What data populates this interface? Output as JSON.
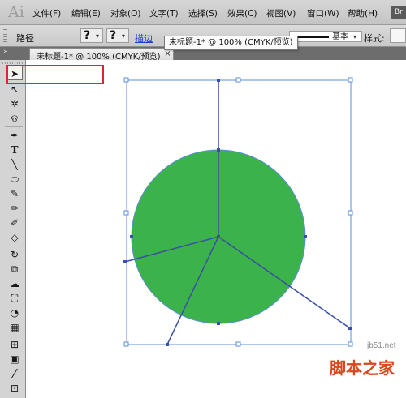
{
  "app": {
    "logo": "Ai",
    "badge": "Br"
  },
  "menu": [
    {
      "label": "文件(F)"
    },
    {
      "label": "编辑(E)"
    },
    {
      "label": "对象(O)"
    },
    {
      "label": "文字(T)"
    },
    {
      "label": "选择(S)"
    },
    {
      "label": "效果(C)"
    },
    {
      "label": "视图(V)"
    },
    {
      "label": "窗口(W)"
    },
    {
      "label": "帮助(H)"
    }
  ],
  "control_bar": {
    "selection_label": "路径",
    "fill_swatch": "?",
    "stroke_swatch": "?",
    "stroke_link": "描边",
    "stroke_style": "基本",
    "style_label": "样式:",
    "dropdown_caret": "▾"
  },
  "tooltip": {
    "text": "未标题-1* @ 100% (CMYK/预览)"
  },
  "document_tab": {
    "label": "未标题-1* @ 100% (CMYK/预览)",
    "close": "×"
  },
  "tools": [
    {
      "name": "selection-tool-icon",
      "glyph": "➤"
    },
    {
      "name": "direct-selection-tool-icon",
      "glyph": "↖"
    },
    {
      "name": "magic-wand-tool-icon",
      "glyph": "✲"
    },
    {
      "name": "lasso-tool-icon",
      "glyph": "ଡ"
    },
    {
      "name": "pen-tool-icon",
      "glyph": "✒"
    },
    {
      "name": "type-tool-icon",
      "glyph": "T"
    },
    {
      "name": "line-segment-tool-icon",
      "glyph": "╲"
    },
    {
      "name": "ellipse-tool-icon",
      "glyph": "⬭"
    },
    {
      "name": "paintbrush-tool-icon",
      "glyph": "✎"
    },
    {
      "name": "pencil-tool-icon",
      "glyph": "✏"
    },
    {
      "name": "blob-brush-tool-icon",
      "glyph": "✐"
    },
    {
      "name": "eraser-tool-icon",
      "glyph": "◇"
    },
    {
      "name": "rotate-tool-icon",
      "glyph": "↻"
    },
    {
      "name": "scale-tool-icon",
      "glyph": "⧉"
    },
    {
      "name": "warp-tool-icon",
      "glyph": "☁"
    },
    {
      "name": "free-transform-tool-icon",
      "glyph": "⛶"
    },
    {
      "name": "shape-builder-tool-icon",
      "glyph": "◔"
    },
    {
      "name": "perspective-grid-tool-icon",
      "glyph": "▦"
    },
    {
      "name": "mesh-tool-icon",
      "glyph": "⊞"
    },
    {
      "name": "gradient-tool-icon",
      "glyph": "▣"
    },
    {
      "name": "eyedropper-tool-icon",
      "glyph": "⁄"
    },
    {
      "name": "blend-tool-icon",
      "glyph": "⊡"
    }
  ],
  "artwork": {
    "fill_color": "#3bb24a",
    "stroke_color": "#3b4ea8",
    "selection_color": "#5b8fd9"
  },
  "watermark": {
    "url": "jb51.net",
    "logo": "脚本之家"
  }
}
